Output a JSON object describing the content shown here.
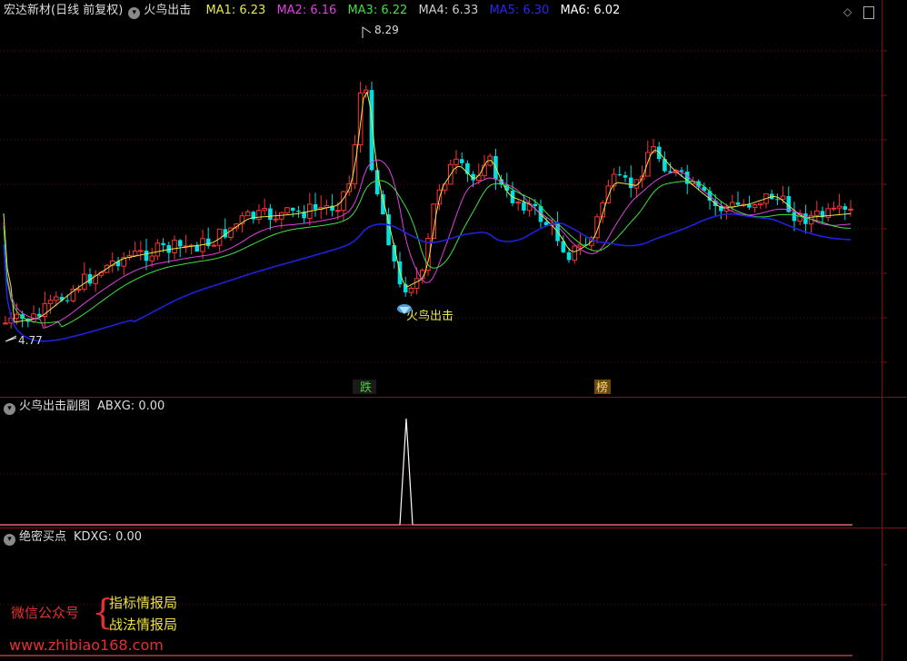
{
  "header": {
    "stock_name": "宏达新材(日线 前复权)",
    "indicator_name": "火鸟出击",
    "ma": [
      {
        "label": "MA1:",
        "value": "6.23",
        "color": "#e8e84a"
      },
      {
        "label": "MA2:",
        "value": "6.16",
        "color": "#e040e0"
      },
      {
        "label": "MA3:",
        "value": "6.22",
        "color": "#40e040"
      },
      {
        "label": "MA4:",
        "value": "6.33",
        "color": "#cccccc"
      },
      {
        "label": "MA5:",
        "value": "6.30",
        "color": "#2020e0"
      },
      {
        "label": "MA6:",
        "value": "6.02",
        "color": "#ffffff"
      }
    ]
  },
  "main_chart": {
    "high_label": "8.29",
    "low_label": "4.77",
    "signal_label": "火鸟出击",
    "markers": [
      "跌",
      "榜"
    ]
  },
  "sub_panel_1": {
    "title": "火鸟出击副图",
    "indicator": "ABXG:",
    "value": "0.00"
  },
  "sub_panel_2": {
    "title": "绝密买点",
    "indicator": "KDXG:",
    "value": "0.00"
  },
  "promo": {
    "wechat_label": "微信公众号",
    "line1": "指标情报局",
    "line2": "战法情报局",
    "website": "www.zhibiao168.com"
  },
  "colors": {
    "up": "#ff3232",
    "down": "#00e0e0",
    "divider": "#7a1010",
    "grid": "#5a1010",
    "label": "#e8e84a",
    "promo_red": "#e53030",
    "promo_yellow": "#f0e040"
  }
}
